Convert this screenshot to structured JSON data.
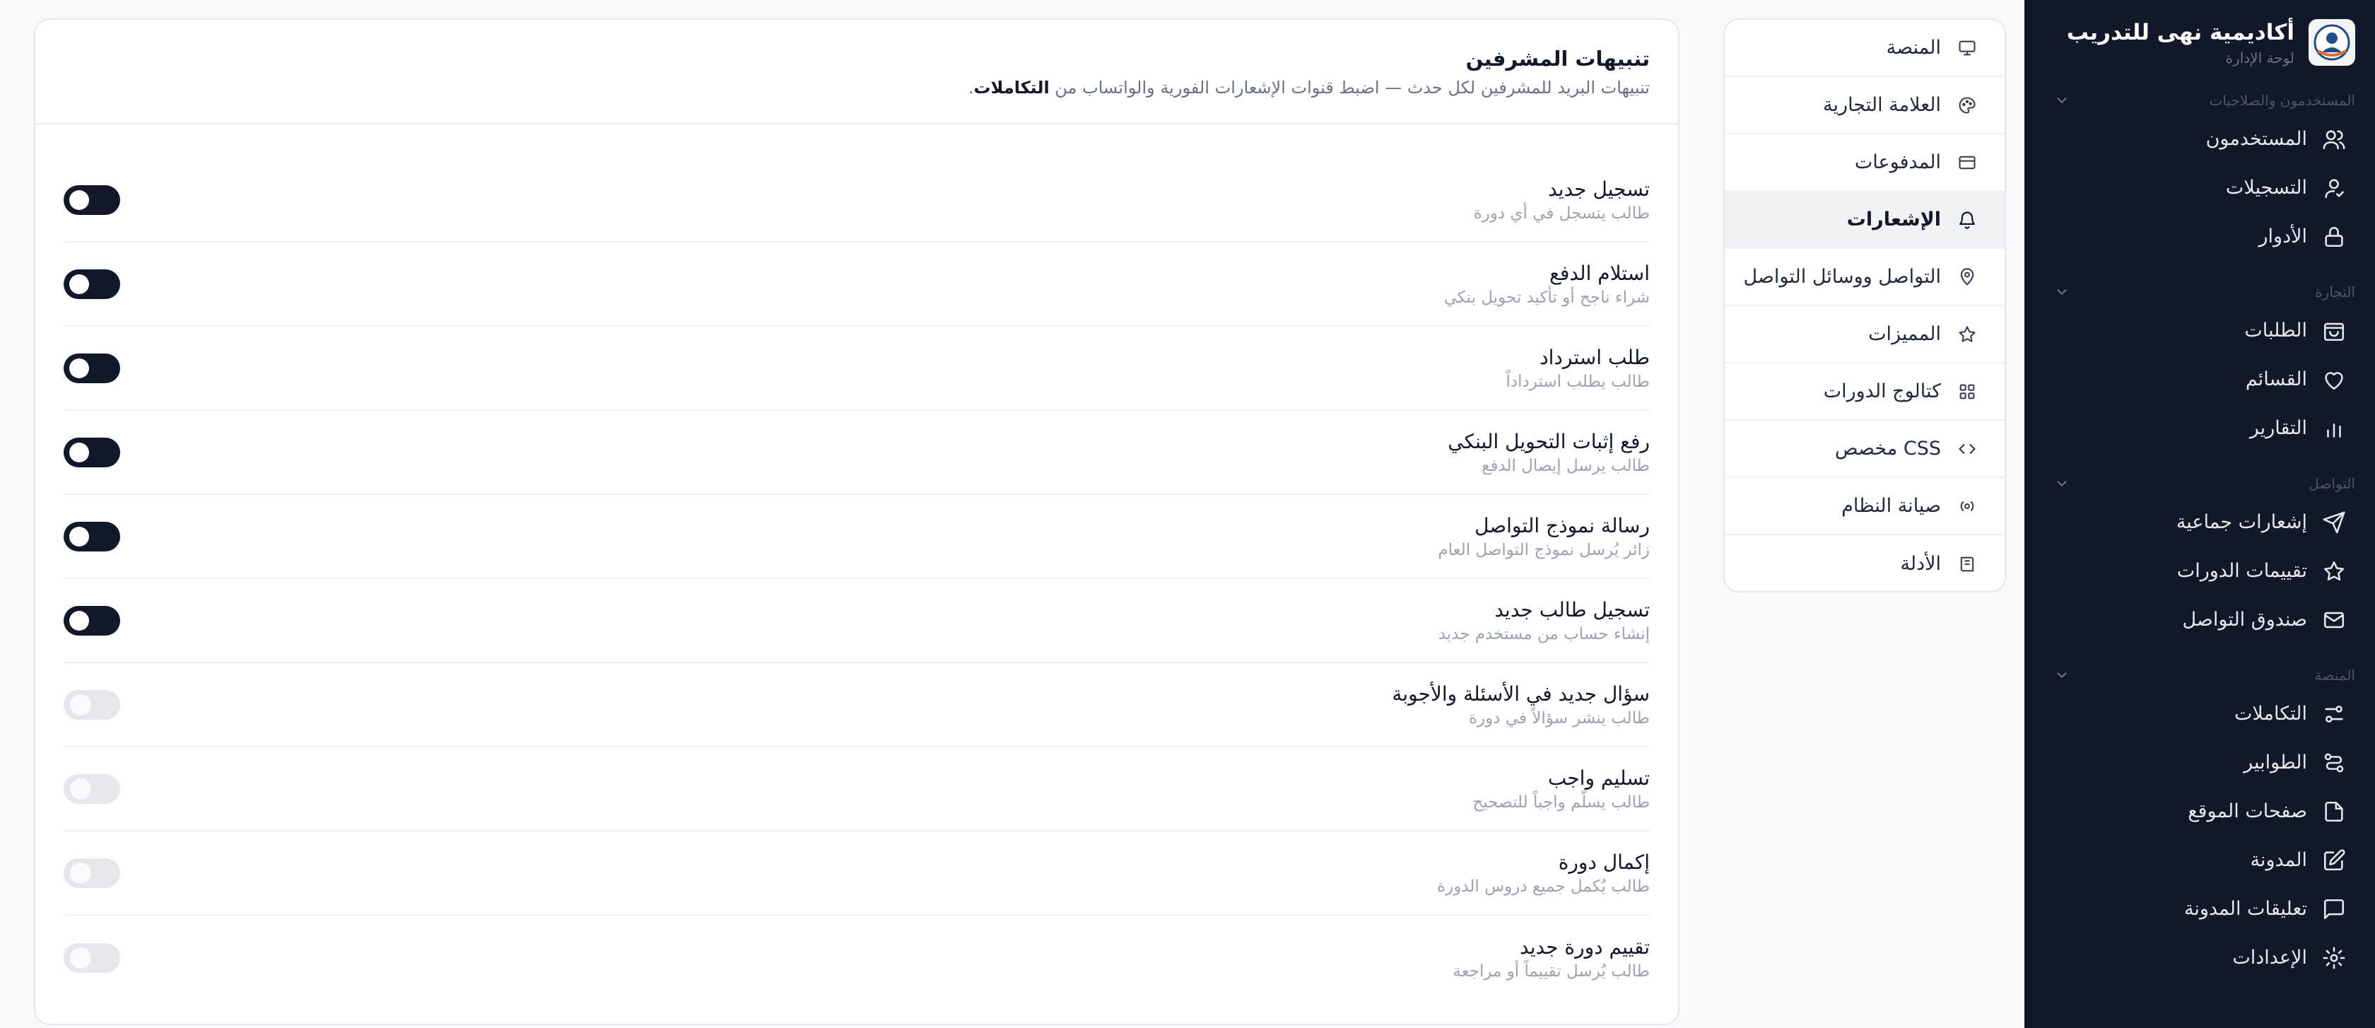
{
  "brand": {
    "name": "أكاديمية نهى للتدريب",
    "subtitle": "لوحة الإدارة"
  },
  "sidebar": {
    "sections": [
      {
        "title": "المستخدمون والصلاحيات",
        "items": [
          {
            "label": "المستخدمون",
            "icon": "users-icon"
          },
          {
            "label": "التسجيلات",
            "icon": "user-check-icon"
          },
          {
            "label": "الأدوار",
            "icon": "lock-icon"
          }
        ]
      },
      {
        "title": "التجارة",
        "items": [
          {
            "label": "الطلبات",
            "icon": "shopping-bag-icon"
          },
          {
            "label": "القسائم",
            "icon": "heart-icon"
          },
          {
            "label": "التقارير",
            "icon": "bar-chart-icon"
          }
        ]
      },
      {
        "title": "التواصل",
        "items": [
          {
            "label": "إشعارات جماعية",
            "icon": "send-icon"
          },
          {
            "label": "تقييمات الدورات",
            "icon": "star-icon"
          },
          {
            "label": "صندوق التواصل",
            "icon": "mail-icon"
          }
        ]
      },
      {
        "title": "المنصة",
        "items": [
          {
            "label": "التكاملات",
            "icon": "sliders-icon"
          },
          {
            "label": "الطوابير",
            "icon": "workflow-icon"
          },
          {
            "label": "صفحات الموقع",
            "icon": "file-icon"
          },
          {
            "label": "المدونة",
            "icon": "edit-icon"
          },
          {
            "label": "تعليقات المدونة",
            "icon": "comment-icon"
          },
          {
            "label": "الإعدادات",
            "icon": "settings-icon"
          }
        ]
      }
    ]
  },
  "submenu": {
    "items": [
      {
        "label": "المنصة",
        "icon": "monitor-icon"
      },
      {
        "label": "العلامة التجارية",
        "icon": "palette-icon"
      },
      {
        "label": "المدفوعات",
        "icon": "credit-card-icon"
      },
      {
        "label": "الإشعارات",
        "icon": "bell-icon",
        "active": true
      },
      {
        "label": "التواصل ووسائل التواصل",
        "icon": "map-pin-icon"
      },
      {
        "label": "المميزات",
        "icon": "star-icon"
      },
      {
        "label": "كتالوج الدورات",
        "icon": "grid-icon"
      },
      {
        "label": "CSS مخصص",
        "icon": "code-icon"
      },
      {
        "label": "صيانة النظام",
        "icon": "maintenance-icon"
      },
      {
        "label": "الأدلة",
        "icon": "book-icon"
      }
    ]
  },
  "panel": {
    "title": "تنبيهات المشرفين",
    "description_prefix": "تنبيهات البريد للمشرفين لكل حدث — اضبط قنوات الإشعارات الفورية والواتساب من ",
    "description_link": "التكاملات",
    "description_suffix": ".",
    "rows": [
      {
        "title": "تسجيل جديد",
        "desc": "طالب يتسجل في أي دورة",
        "enabled": true
      },
      {
        "title": "استلام الدفع",
        "desc": "شراء ناجح أو تأكيد تحويل بنكي",
        "enabled": true
      },
      {
        "title": "طلب استرداد",
        "desc": "طالب يطلب استرداداً",
        "enabled": true
      },
      {
        "title": "رفع إثبات التحويل البنكي",
        "desc": "طالب يرسل إيصال الدفع",
        "enabled": true
      },
      {
        "title": "رسالة نموذج التواصل",
        "desc": "زائر يُرسل نموذج التواصل العام",
        "enabled": true
      },
      {
        "title": "تسجيل طالب جديد",
        "desc": "إنشاء حساب من مستخدم جديد",
        "enabled": true
      },
      {
        "title": "سؤال جديد في الأسئلة والأجوبة",
        "desc": "طالب ينشر سؤالاً في دورة",
        "enabled": false
      },
      {
        "title": "تسليم واجب",
        "desc": "طالب يسلّم واجباً للتصحيح",
        "enabled": false
      },
      {
        "title": "إكمال دورة",
        "desc": "طالب يُكمل جميع دروس الدورة",
        "enabled": false
      },
      {
        "title": "تقييم دورة جديد",
        "desc": "طالب يُرسل تقييماً أو مراجعة",
        "enabled": false
      }
    ]
  }
}
